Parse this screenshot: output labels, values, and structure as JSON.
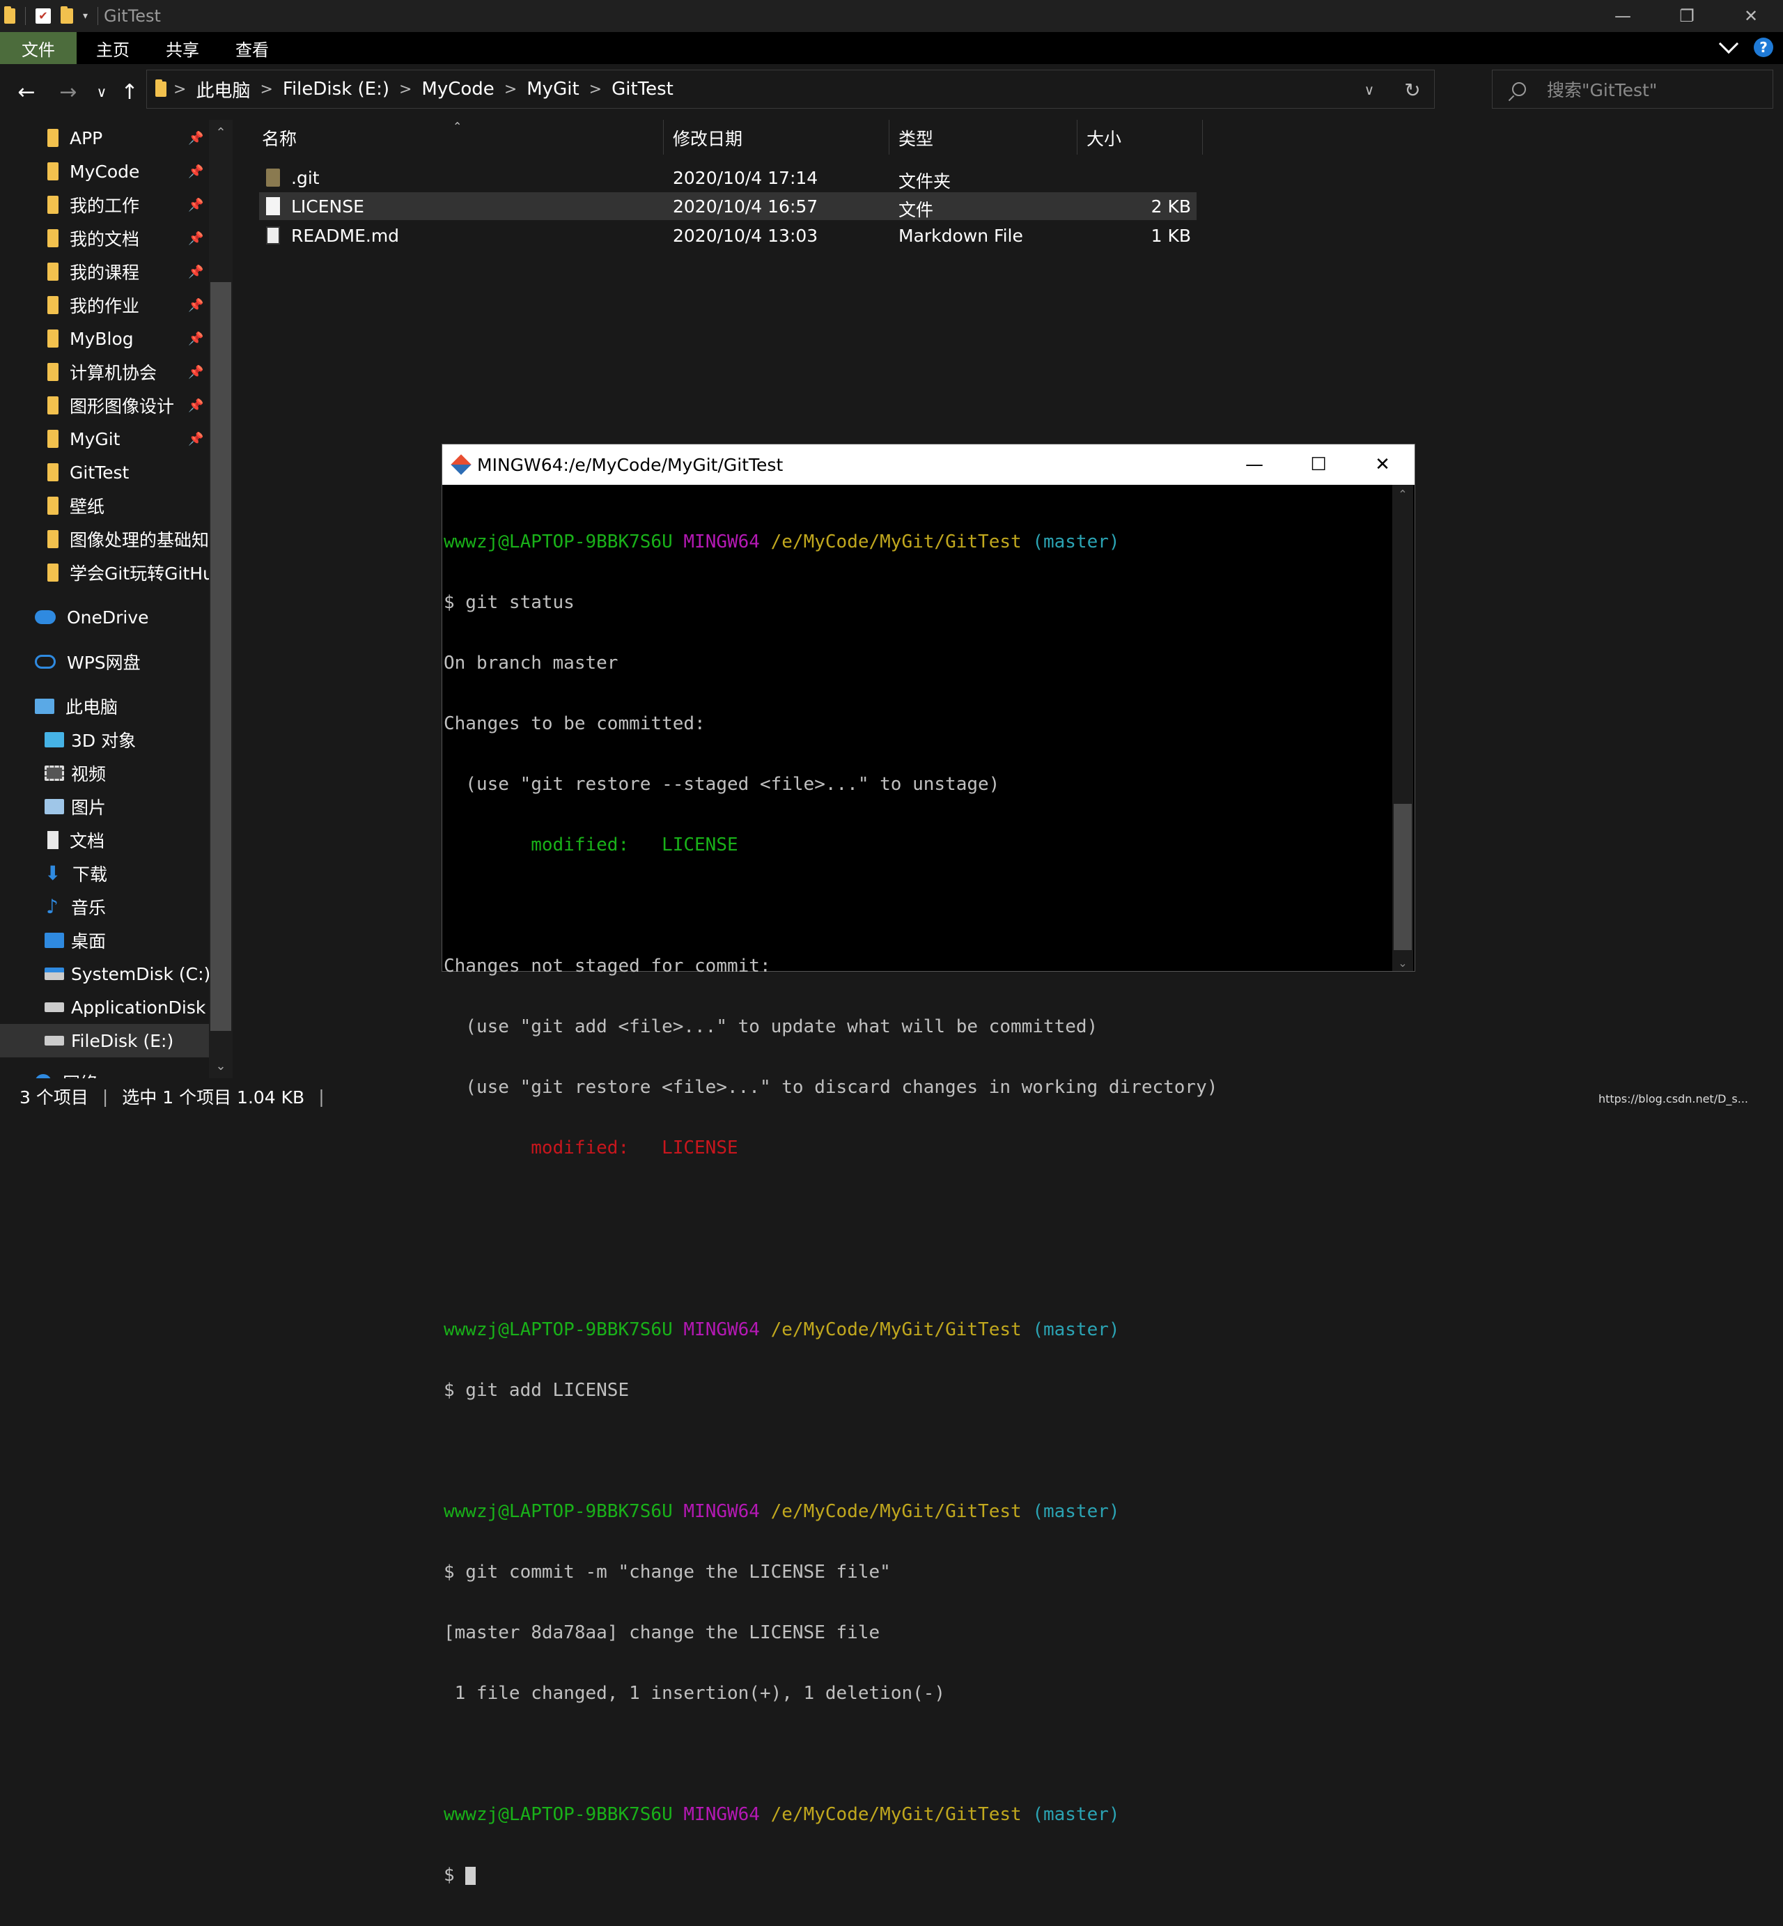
{
  "window": {
    "title": "GitTest",
    "controls": {
      "minimize": "—",
      "restore": "❐",
      "close": "✕"
    }
  },
  "ribbon": {
    "tabs": [
      "文件",
      "主页",
      "共享",
      "查看"
    ],
    "help": "?"
  },
  "nav": {
    "back": "←",
    "forward": "→",
    "recent": "∨",
    "up": "↑",
    "breadcrumbs": [
      "此电脑",
      "FileDisk (E:)",
      "MyCode",
      "MyGit",
      "GitTest"
    ],
    "separator": ">",
    "dropdown": "∨",
    "refresh": "↻",
    "search_placeholder": "搜索\"GitTest\""
  },
  "sidebar": {
    "quick_access": [
      {
        "label": "APP",
        "pinned": true
      },
      {
        "label": "MyCode",
        "pinned": true
      },
      {
        "label": "我的工作",
        "pinned": true
      },
      {
        "label": "我的文档",
        "pinned": true
      },
      {
        "label": "我的课程",
        "pinned": true
      },
      {
        "label": "我的作业",
        "pinned": true
      },
      {
        "label": "MyBlog",
        "pinned": true
      },
      {
        "label": "计算机协会",
        "pinned": true
      },
      {
        "label": "图形图像设计",
        "pinned": true
      },
      {
        "label": "MyGit",
        "pinned": true
      },
      {
        "label": "GitTest",
        "pinned": false
      },
      {
        "label": "壁纸",
        "pinned": false
      },
      {
        "label": "图像处理的基础知识",
        "pinned": false
      },
      {
        "label": "学会Git玩转GitHub",
        "pinned": false
      }
    ],
    "onedrive": "OneDrive",
    "wps": "WPS网盘",
    "this_pc": "此电脑",
    "pc_items": [
      "3D 对象",
      "视频",
      "图片",
      "文档",
      "下载",
      "音乐",
      "桌面",
      "SystemDisk (C:)",
      "ApplicationDisk (D:)",
      "FileDisk (E:)"
    ],
    "network": "网络",
    "pin_glyph": "📌"
  },
  "columns": [
    "名称",
    "修改日期",
    "类型",
    "大小"
  ],
  "files": [
    {
      "name": ".git",
      "modified": "2020/10/4 17:14",
      "type": "文件夹",
      "size": "",
      "icon": "folder-icon"
    },
    {
      "name": "LICENSE",
      "modified": "2020/10/4 16:57",
      "type": "文件",
      "size": "2 KB",
      "icon": "file-icon"
    },
    {
      "name": "README.md",
      "modified": "2020/10/4 13:03",
      "type": "Markdown File",
      "size": "1 KB",
      "icon": "markdown-file-icon"
    }
  ],
  "status": {
    "count": "3 个项目",
    "selection": "选中 1 个项目  1.04 KB",
    "watermark": "https://blog.csdn.net/D_s..."
  },
  "terminal": {
    "title": "MINGW64:/e/MyCode/MyGit/GitTest",
    "prompt": {
      "user": "wwwzj@LAPTOP-9BBK7S6U",
      "env": "MINGW64",
      "path": "/e/MyCode/MyGit/GitTest",
      "branch": "(master)"
    },
    "lines": {
      "cmd1": "$ git status",
      "o1": "On branch master",
      "o2": "Changes to be committed:",
      "o3": "  (use \"git restore --staged <file>...\" to unstage)",
      "o4": "        modified:   LICENSE",
      "o5": "Changes not staged for commit:",
      "o6": "  (use \"git add <file>...\" to update what will be committed)",
      "o7": "  (use \"git restore <file>...\" to discard changes in working directory)",
      "o8": "        modified:   LICENSE",
      "cmd2": "$ git add LICENSE",
      "cmd3": "$ git commit -m \"change the LICENSE file\"",
      "o9": "[master 8da78aa] change the LICENSE file",
      "o10": " 1 file changed, 1 insertion(+), 1 deletion(-)",
      "cmd4": "$ "
    }
  }
}
